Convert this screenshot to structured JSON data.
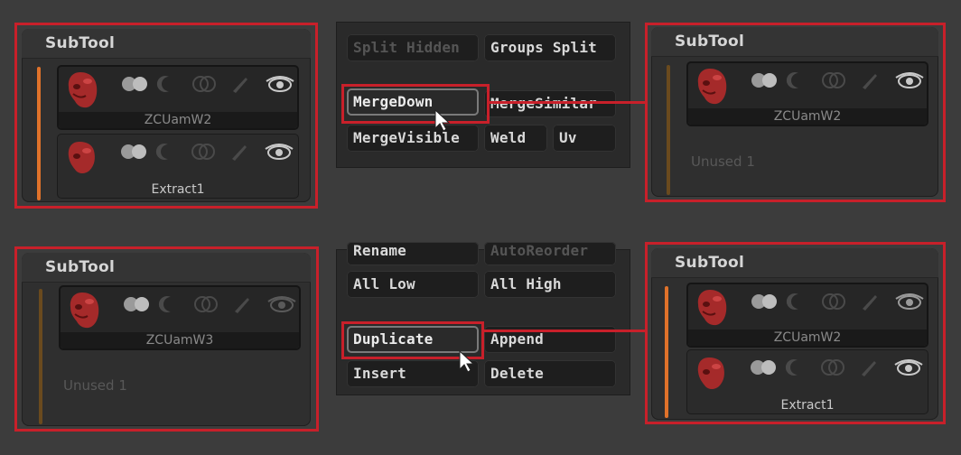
{
  "palettes": {
    "top_left": {
      "title": "SubTool",
      "slots": [
        {
          "name": "ZCUamW2",
          "active": true
        },
        {
          "name": "Extract1",
          "active": false
        }
      ]
    },
    "top_right": {
      "title": "SubTool",
      "slots": [
        {
          "name": "ZCUamW2",
          "active": true
        }
      ],
      "unused_label": "Unused  1"
    },
    "bottom_left": {
      "title": "SubTool",
      "slots": [
        {
          "name": "ZCUamW3",
          "active": true
        }
      ],
      "unused_label": "Unused  1"
    },
    "bottom_right": {
      "title": "SubTool",
      "slots": [
        {
          "name": "ZCUamW2",
          "active": true
        },
        {
          "name": "Extract1",
          "active": false
        }
      ]
    }
  },
  "top_buttons": {
    "split_hidden": "Split Hidden",
    "groups_split": "Groups Split",
    "merge_down": "MergeDown",
    "merge_similar": "MergeSimilar",
    "merge_visible": "MergeVisible",
    "weld": "Weld",
    "uv": "Uv"
  },
  "bottom_buttons": {
    "rename": "Rename",
    "auto_reorder": "AutoReorder",
    "all_low": "All Low",
    "all_high": "All High",
    "duplicate": "Duplicate",
    "append": "Append",
    "insert": "Insert",
    "delete": "Delete"
  },
  "colors": {
    "highlight_frame": "#c8202a",
    "active_bar": "#e0722a",
    "inactive_bar": "#6a4a1e",
    "model_red": "#a52a2a"
  },
  "icons": [
    "head-thumbnail-icon",
    "polyframe-icon",
    "solo-icon",
    "transparency-icon",
    "brush-icon",
    "eye-icon"
  ]
}
